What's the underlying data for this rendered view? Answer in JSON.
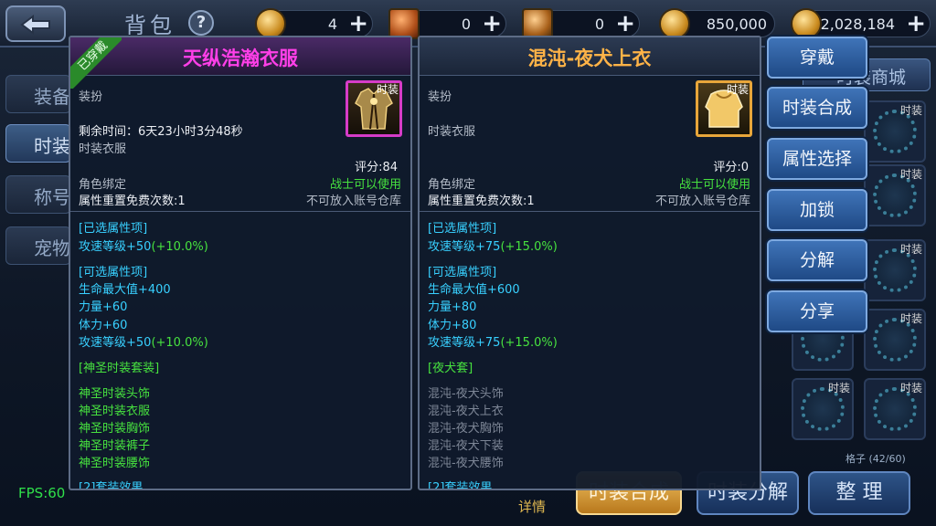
{
  "header": {
    "title": "背包",
    "resources": [
      {
        "icon": "gold-coin-icon",
        "value": "4"
      },
      {
        "icon": "scroll-icon",
        "value": "0"
      },
      {
        "icon": "ticket-icon",
        "value": "0"
      },
      {
        "icon": "bound-gold-icon",
        "value": "850,000"
      },
      {
        "icon": "gold-ingot-icon",
        "value": "2,028,184"
      }
    ]
  },
  "sidebar": {
    "tabs": [
      {
        "label": "装备"
      },
      {
        "label": "时装"
      },
      {
        "label": "称号"
      },
      {
        "label": "宠物"
      }
    ]
  },
  "shop_tab": "时装商城",
  "grid": {
    "cell_tag": "时装",
    "capacity": "格子 (42/60)"
  },
  "bottom": {
    "detail": "详情",
    "synth": "时装合成",
    "decompose": "时装分解",
    "sort": "整 理"
  },
  "fps": "FPS:60",
  "left_item": {
    "equipped_label": "已穿戴",
    "name": "天纵浩瀚衣服",
    "name_color": "#ff3fe8",
    "category": "装扮",
    "icon_tag": "时装",
    "remaining_time": "剩余时间：6天23小时3分48秒",
    "type": "时装衣服",
    "score": "评分:84",
    "bind": "角色绑定",
    "class_req": "战士可以使用",
    "reset_count": "属性重置免费次数:1",
    "storage": "不可放入账号仓库",
    "selected_header": "[已选属性项]",
    "selected_attrs": [
      {
        "text": "攻速等级+50",
        "bonus": "(+10.0%)"
      }
    ],
    "optional_header": "[可选属性项]",
    "optional_attrs": [
      {
        "text": "生命最大值+400",
        "bonus": ""
      },
      {
        "text": "力量+60",
        "bonus": ""
      },
      {
        "text": "体力+60",
        "bonus": ""
      },
      {
        "text": "攻速等级+50",
        "bonus": "(+10.0%)"
      }
    ],
    "set_name": "[神圣时装套装]",
    "set_items": [
      "神圣时装头饰",
      "神圣时装衣服",
      "神圣时装胸饰",
      "神圣时装裤子",
      "神圣时装腰饰"
    ],
    "set_effect": "[2]套装效果"
  },
  "right_item": {
    "name": "混沌-夜犬上衣",
    "name_color": "#ffb347",
    "category": "装扮",
    "icon_tag": "时装",
    "type": "时装衣服",
    "score": "评分:0",
    "bind": "角色绑定",
    "class_req": "战士可以使用",
    "reset_count": "属性重置免费次数:1",
    "storage": "不可放入账号仓库",
    "selected_header": "[已选属性项]",
    "selected_attrs": [
      {
        "text": "攻速等级+75",
        "bonus": "(+15.0%)"
      }
    ],
    "optional_header": "[可选属性项]",
    "optional_attrs": [
      {
        "text": "生命最大值+600",
        "bonus": ""
      },
      {
        "text": "力量+80",
        "bonus": ""
      },
      {
        "text": "体力+80",
        "bonus": ""
      },
      {
        "text": "攻速等级+75",
        "bonus": "(+15.0%)"
      }
    ],
    "set_name": "[夜犬套]",
    "set_items": [
      "混沌-夜犬头饰",
      "混沌-夜犬上衣",
      "混沌-夜犬胸饰",
      "混沌-夜犬下装",
      "混沌-夜犬腰饰"
    ],
    "set_effect": "[2]套装效果"
  },
  "actions": [
    "穿戴",
    "时装合成",
    "属性选择",
    "加锁",
    "分解",
    "分享"
  ]
}
